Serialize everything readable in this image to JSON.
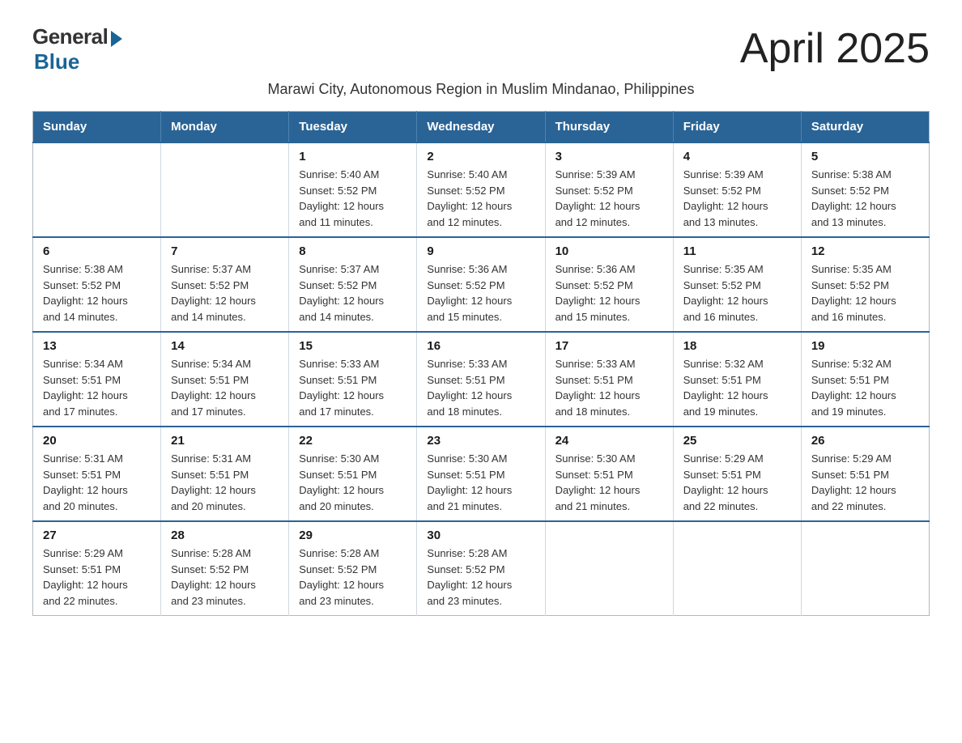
{
  "logo": {
    "general": "General",
    "blue": "Blue"
  },
  "title": "April 2025",
  "subtitle": "Marawi City, Autonomous Region in Muslim Mindanao, Philippines",
  "header": {
    "days": [
      "Sunday",
      "Monday",
      "Tuesday",
      "Wednesday",
      "Thursday",
      "Friday",
      "Saturday"
    ]
  },
  "weeks": [
    {
      "days": [
        {
          "number": "",
          "detail": ""
        },
        {
          "number": "",
          "detail": ""
        },
        {
          "number": "1",
          "detail": "Sunrise: 5:40 AM\nSunset: 5:52 PM\nDaylight: 12 hours\nand 11 minutes."
        },
        {
          "number": "2",
          "detail": "Sunrise: 5:40 AM\nSunset: 5:52 PM\nDaylight: 12 hours\nand 12 minutes."
        },
        {
          "number": "3",
          "detail": "Sunrise: 5:39 AM\nSunset: 5:52 PM\nDaylight: 12 hours\nand 12 minutes."
        },
        {
          "number": "4",
          "detail": "Sunrise: 5:39 AM\nSunset: 5:52 PM\nDaylight: 12 hours\nand 13 minutes."
        },
        {
          "number": "5",
          "detail": "Sunrise: 5:38 AM\nSunset: 5:52 PM\nDaylight: 12 hours\nand 13 minutes."
        }
      ]
    },
    {
      "days": [
        {
          "number": "6",
          "detail": "Sunrise: 5:38 AM\nSunset: 5:52 PM\nDaylight: 12 hours\nand 14 minutes."
        },
        {
          "number": "7",
          "detail": "Sunrise: 5:37 AM\nSunset: 5:52 PM\nDaylight: 12 hours\nand 14 minutes."
        },
        {
          "number": "8",
          "detail": "Sunrise: 5:37 AM\nSunset: 5:52 PM\nDaylight: 12 hours\nand 14 minutes."
        },
        {
          "number": "9",
          "detail": "Sunrise: 5:36 AM\nSunset: 5:52 PM\nDaylight: 12 hours\nand 15 minutes."
        },
        {
          "number": "10",
          "detail": "Sunrise: 5:36 AM\nSunset: 5:52 PM\nDaylight: 12 hours\nand 15 minutes."
        },
        {
          "number": "11",
          "detail": "Sunrise: 5:35 AM\nSunset: 5:52 PM\nDaylight: 12 hours\nand 16 minutes."
        },
        {
          "number": "12",
          "detail": "Sunrise: 5:35 AM\nSunset: 5:52 PM\nDaylight: 12 hours\nand 16 minutes."
        }
      ]
    },
    {
      "days": [
        {
          "number": "13",
          "detail": "Sunrise: 5:34 AM\nSunset: 5:51 PM\nDaylight: 12 hours\nand 17 minutes."
        },
        {
          "number": "14",
          "detail": "Sunrise: 5:34 AM\nSunset: 5:51 PM\nDaylight: 12 hours\nand 17 minutes."
        },
        {
          "number": "15",
          "detail": "Sunrise: 5:33 AM\nSunset: 5:51 PM\nDaylight: 12 hours\nand 17 minutes."
        },
        {
          "number": "16",
          "detail": "Sunrise: 5:33 AM\nSunset: 5:51 PM\nDaylight: 12 hours\nand 18 minutes."
        },
        {
          "number": "17",
          "detail": "Sunrise: 5:33 AM\nSunset: 5:51 PM\nDaylight: 12 hours\nand 18 minutes."
        },
        {
          "number": "18",
          "detail": "Sunrise: 5:32 AM\nSunset: 5:51 PM\nDaylight: 12 hours\nand 19 minutes."
        },
        {
          "number": "19",
          "detail": "Sunrise: 5:32 AM\nSunset: 5:51 PM\nDaylight: 12 hours\nand 19 minutes."
        }
      ]
    },
    {
      "days": [
        {
          "number": "20",
          "detail": "Sunrise: 5:31 AM\nSunset: 5:51 PM\nDaylight: 12 hours\nand 20 minutes."
        },
        {
          "number": "21",
          "detail": "Sunrise: 5:31 AM\nSunset: 5:51 PM\nDaylight: 12 hours\nand 20 minutes."
        },
        {
          "number": "22",
          "detail": "Sunrise: 5:30 AM\nSunset: 5:51 PM\nDaylight: 12 hours\nand 20 minutes."
        },
        {
          "number": "23",
          "detail": "Sunrise: 5:30 AM\nSunset: 5:51 PM\nDaylight: 12 hours\nand 21 minutes."
        },
        {
          "number": "24",
          "detail": "Sunrise: 5:30 AM\nSunset: 5:51 PM\nDaylight: 12 hours\nand 21 minutes."
        },
        {
          "number": "25",
          "detail": "Sunrise: 5:29 AM\nSunset: 5:51 PM\nDaylight: 12 hours\nand 22 minutes."
        },
        {
          "number": "26",
          "detail": "Sunrise: 5:29 AM\nSunset: 5:51 PM\nDaylight: 12 hours\nand 22 minutes."
        }
      ]
    },
    {
      "days": [
        {
          "number": "27",
          "detail": "Sunrise: 5:29 AM\nSunset: 5:51 PM\nDaylight: 12 hours\nand 22 minutes."
        },
        {
          "number": "28",
          "detail": "Sunrise: 5:28 AM\nSunset: 5:52 PM\nDaylight: 12 hours\nand 23 minutes."
        },
        {
          "number": "29",
          "detail": "Sunrise: 5:28 AM\nSunset: 5:52 PM\nDaylight: 12 hours\nand 23 minutes."
        },
        {
          "number": "30",
          "detail": "Sunrise: 5:28 AM\nSunset: 5:52 PM\nDaylight: 12 hours\nand 23 minutes."
        },
        {
          "number": "",
          "detail": ""
        },
        {
          "number": "",
          "detail": ""
        },
        {
          "number": "",
          "detail": ""
        }
      ]
    }
  ]
}
